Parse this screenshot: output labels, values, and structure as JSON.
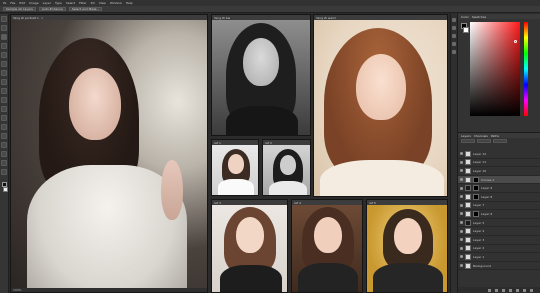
{
  "menubar": {
    "items": [
      "Ps",
      "File",
      "Edit",
      "Image",
      "Layer",
      "Type",
      "Select",
      "Filter",
      "3D",
      "View",
      "Window",
      "Help"
    ]
  },
  "optionsbar": {
    "items": [
      "Sample All Layers",
      "Auto-Enhance",
      "Select and Mask..."
    ]
  },
  "documents": [
    {
      "tab": "Yang Zi portrait 1",
      "status": "100%"
    },
    {
      "tab": "Yang Zi bw",
      "status": ""
    },
    {
      "tab": "Yang Zi warm",
      "status": ""
    },
    {
      "tab": "ref 1",
      "status": ""
    },
    {
      "tab": "ref 2",
      "status": ""
    },
    {
      "tab": "ref 3",
      "status": ""
    },
    {
      "tab": "ref 4",
      "status": ""
    },
    {
      "tab": "ref 5",
      "status": ""
    }
  ],
  "panels": {
    "color_tabs": [
      "Color",
      "Swatches"
    ],
    "layers_tabs": [
      "Layers",
      "Channels",
      "Paths"
    ],
    "layers": [
      {
        "name": "Layer 12",
        "thumb": "light",
        "mask": false,
        "active": false
      },
      {
        "name": "Layer 11",
        "thumb": "light",
        "mask": false,
        "active": false
      },
      {
        "name": "Layer 10",
        "thumb": "light",
        "mask": false,
        "active": false
      },
      {
        "name": "Curves 1",
        "thumb": "light",
        "mask": true,
        "active": true
      },
      {
        "name": "Layer 9",
        "thumb": "dark",
        "mask": true,
        "active": false
      },
      {
        "name": "Layer 8",
        "thumb": "light",
        "mask": true,
        "active": false
      },
      {
        "name": "Layer 7",
        "thumb": "light",
        "mask": false,
        "active": false
      },
      {
        "name": "Layer 6",
        "thumb": "light",
        "mask": true,
        "active": false
      },
      {
        "name": "Layer 5",
        "thumb": "dark",
        "mask": false,
        "active": false
      },
      {
        "name": "Layer 4",
        "thumb": "light",
        "mask": false,
        "active": false
      },
      {
        "name": "Layer 3",
        "thumb": "light",
        "mask": false,
        "active": false
      },
      {
        "name": "Layer 2",
        "thumb": "light",
        "mask": false,
        "active": false
      },
      {
        "name": "Layer 1",
        "thumb": "light",
        "mask": false,
        "active": false
      },
      {
        "name": "Background",
        "thumb": "light",
        "mask": false,
        "active": false
      }
    ]
  },
  "colors": {
    "accent_red": "#ff1a1a",
    "foreground": "#000000",
    "background": "#ffffff"
  }
}
